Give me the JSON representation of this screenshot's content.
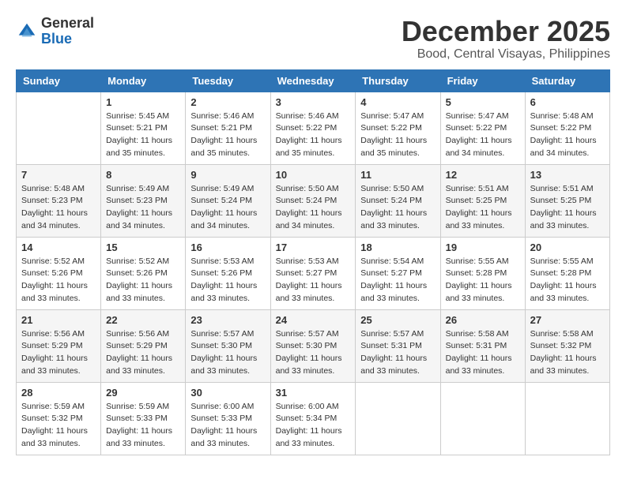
{
  "logo": {
    "general": "General",
    "blue": "Blue"
  },
  "header": {
    "month": "December 2025",
    "location": "Bood, Central Visayas, Philippines"
  },
  "days_of_week": [
    "Sunday",
    "Monday",
    "Tuesday",
    "Wednesday",
    "Thursday",
    "Friday",
    "Saturday"
  ],
  "weeks": [
    [
      {
        "day": "",
        "info": ""
      },
      {
        "day": "1",
        "info": "Sunrise: 5:45 AM\nSunset: 5:21 PM\nDaylight: 11 hours and 35 minutes."
      },
      {
        "day": "2",
        "info": "Sunrise: 5:46 AM\nSunset: 5:21 PM\nDaylight: 11 hours and 35 minutes."
      },
      {
        "day": "3",
        "info": "Sunrise: 5:46 AM\nSunset: 5:22 PM\nDaylight: 11 hours and 35 minutes."
      },
      {
        "day": "4",
        "info": "Sunrise: 5:47 AM\nSunset: 5:22 PM\nDaylight: 11 hours and 35 minutes."
      },
      {
        "day": "5",
        "info": "Sunrise: 5:47 AM\nSunset: 5:22 PM\nDaylight: 11 hours and 34 minutes."
      },
      {
        "day": "6",
        "info": "Sunrise: 5:48 AM\nSunset: 5:22 PM\nDaylight: 11 hours and 34 minutes."
      }
    ],
    [
      {
        "day": "7",
        "info": "Sunrise: 5:48 AM\nSunset: 5:23 PM\nDaylight: 11 hours and 34 minutes."
      },
      {
        "day": "8",
        "info": "Sunrise: 5:49 AM\nSunset: 5:23 PM\nDaylight: 11 hours and 34 minutes."
      },
      {
        "day": "9",
        "info": "Sunrise: 5:49 AM\nSunset: 5:24 PM\nDaylight: 11 hours and 34 minutes."
      },
      {
        "day": "10",
        "info": "Sunrise: 5:50 AM\nSunset: 5:24 PM\nDaylight: 11 hours and 34 minutes."
      },
      {
        "day": "11",
        "info": "Sunrise: 5:50 AM\nSunset: 5:24 PM\nDaylight: 11 hours and 33 minutes."
      },
      {
        "day": "12",
        "info": "Sunrise: 5:51 AM\nSunset: 5:25 PM\nDaylight: 11 hours and 33 minutes."
      },
      {
        "day": "13",
        "info": "Sunrise: 5:51 AM\nSunset: 5:25 PM\nDaylight: 11 hours and 33 minutes."
      }
    ],
    [
      {
        "day": "14",
        "info": "Sunrise: 5:52 AM\nSunset: 5:26 PM\nDaylight: 11 hours and 33 minutes."
      },
      {
        "day": "15",
        "info": "Sunrise: 5:52 AM\nSunset: 5:26 PM\nDaylight: 11 hours and 33 minutes."
      },
      {
        "day": "16",
        "info": "Sunrise: 5:53 AM\nSunset: 5:26 PM\nDaylight: 11 hours and 33 minutes."
      },
      {
        "day": "17",
        "info": "Sunrise: 5:53 AM\nSunset: 5:27 PM\nDaylight: 11 hours and 33 minutes."
      },
      {
        "day": "18",
        "info": "Sunrise: 5:54 AM\nSunset: 5:27 PM\nDaylight: 11 hours and 33 minutes."
      },
      {
        "day": "19",
        "info": "Sunrise: 5:55 AM\nSunset: 5:28 PM\nDaylight: 11 hours and 33 minutes."
      },
      {
        "day": "20",
        "info": "Sunrise: 5:55 AM\nSunset: 5:28 PM\nDaylight: 11 hours and 33 minutes."
      }
    ],
    [
      {
        "day": "21",
        "info": "Sunrise: 5:56 AM\nSunset: 5:29 PM\nDaylight: 11 hours and 33 minutes."
      },
      {
        "day": "22",
        "info": "Sunrise: 5:56 AM\nSunset: 5:29 PM\nDaylight: 11 hours and 33 minutes."
      },
      {
        "day": "23",
        "info": "Sunrise: 5:57 AM\nSunset: 5:30 PM\nDaylight: 11 hours and 33 minutes."
      },
      {
        "day": "24",
        "info": "Sunrise: 5:57 AM\nSunset: 5:30 PM\nDaylight: 11 hours and 33 minutes."
      },
      {
        "day": "25",
        "info": "Sunrise: 5:57 AM\nSunset: 5:31 PM\nDaylight: 11 hours and 33 minutes."
      },
      {
        "day": "26",
        "info": "Sunrise: 5:58 AM\nSunset: 5:31 PM\nDaylight: 11 hours and 33 minutes."
      },
      {
        "day": "27",
        "info": "Sunrise: 5:58 AM\nSunset: 5:32 PM\nDaylight: 11 hours and 33 minutes."
      }
    ],
    [
      {
        "day": "28",
        "info": "Sunrise: 5:59 AM\nSunset: 5:32 PM\nDaylight: 11 hours and 33 minutes."
      },
      {
        "day": "29",
        "info": "Sunrise: 5:59 AM\nSunset: 5:33 PM\nDaylight: 11 hours and 33 minutes."
      },
      {
        "day": "30",
        "info": "Sunrise: 6:00 AM\nSunset: 5:33 PM\nDaylight: 11 hours and 33 minutes."
      },
      {
        "day": "31",
        "info": "Sunrise: 6:00 AM\nSunset: 5:34 PM\nDaylight: 11 hours and 33 minutes."
      },
      {
        "day": "",
        "info": ""
      },
      {
        "day": "",
        "info": ""
      },
      {
        "day": "",
        "info": ""
      }
    ]
  ]
}
